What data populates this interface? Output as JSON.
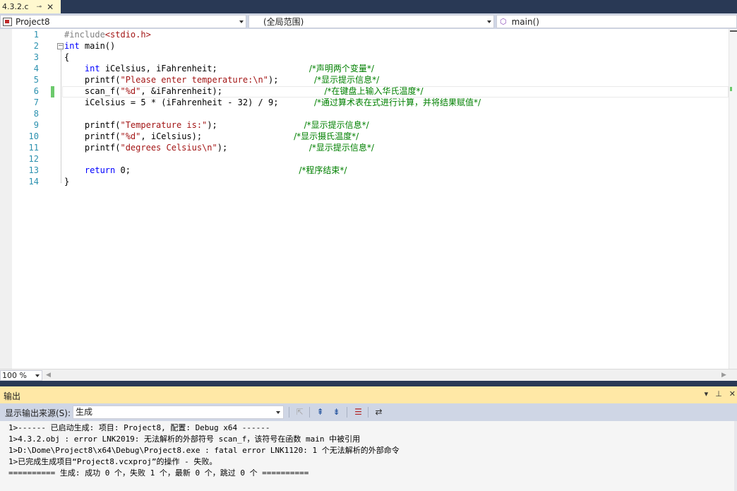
{
  "tab": {
    "title": "4.3.2.c",
    "pin": "⊸",
    "close": "✕"
  },
  "nav": {
    "project": "Project8",
    "scope": "(全局范围)",
    "member": "main()"
  },
  "editor": {
    "line_numbers": [
      "1",
      "2",
      "3",
      "4",
      "5",
      "6",
      "7",
      "8",
      "9",
      "10",
      "11",
      "12",
      "13",
      "14"
    ],
    "zoom": "100 %",
    "collapse_glyph": "−",
    "lines": [
      [
        {
          "t": "pp",
          "v": "#include"
        },
        {
          "t": "str",
          "v": "<stdio.h>"
        }
      ],
      [
        {
          "t": "kw",
          "v": "int"
        },
        {
          "t": "",
          "v": " main()"
        }
      ],
      [
        {
          "t": "",
          "v": "{"
        }
      ],
      [
        {
          "t": "",
          "v": "    "
        },
        {
          "t": "kw",
          "v": "int"
        },
        {
          "t": "",
          "v": " iCelsius, iFahrenheit;                  "
        },
        {
          "t": "cm",
          "v": "/*声明两个变量*/"
        }
      ],
      [
        {
          "t": "",
          "v": "    printf("
        },
        {
          "t": "str",
          "v": "\"Please enter temperature:\\n\""
        },
        {
          "t": "",
          "v": ");       "
        },
        {
          "t": "cm",
          "v": "/*显示提示信息*/"
        }
      ],
      [
        {
          "t": "",
          "v": "    scan_f("
        },
        {
          "t": "str",
          "v": "\"%d\""
        },
        {
          "t": "",
          "v": ", &iFahrenheit);                    "
        },
        {
          "t": "cm",
          "v": "/*在键盘上输入华氏温度*/"
        }
      ],
      [
        {
          "t": "",
          "v": "    iCelsius = 5 * (iFahrenheit - 32) / 9;       "
        },
        {
          "t": "cm",
          "v": "/*通过算术表在式进行计算，并将结果赋值*/"
        }
      ],
      [
        {
          "t": "",
          "v": ""
        }
      ],
      [
        {
          "t": "",
          "v": "    printf("
        },
        {
          "t": "str",
          "v": "\"Temperature is:\""
        },
        {
          "t": "",
          "v": ");                 "
        },
        {
          "t": "cm",
          "v": "/*显示提示信息*/"
        }
      ],
      [
        {
          "t": "",
          "v": "    printf("
        },
        {
          "t": "str",
          "v": "\"%d\""
        },
        {
          "t": "",
          "v": ", iCelsius);                  "
        },
        {
          "t": "cm",
          "v": "/*显示摄氏温度*/"
        }
      ],
      [
        {
          "t": "",
          "v": "    printf("
        },
        {
          "t": "str",
          "v": "\"degrees Celsius\\n\""
        },
        {
          "t": "",
          "v": ");                "
        },
        {
          "t": "cm",
          "v": "/*显示提示信息*/"
        }
      ],
      [
        {
          "t": "",
          "v": ""
        }
      ],
      [
        {
          "t": "",
          "v": "    "
        },
        {
          "t": "kw",
          "v": "return"
        },
        {
          "t": "",
          "v": " 0;                                 "
        },
        {
          "t": "cm",
          "v": "/*程序结束*/"
        }
      ],
      [
        {
          "t": "",
          "v": "}"
        }
      ]
    ]
  },
  "output": {
    "title": "输出",
    "source_label": "显示输出来源(S):",
    "source_value": "生成",
    "title_icons": {
      "dropdown": "▾",
      "pin": "⊥",
      "close": "✕"
    },
    "lines": [
      "1>------ 已启动生成: 项目: Project8, 配置: Debug x64 ------",
      "1>4.3.2.obj : error LNK2019: 无法解析的外部符号 scan_f，该符号在函数 main 中被引用",
      "1>D:\\Dome\\Project8\\x64\\Debug\\Project8.exe : fatal error LNK1120: 1 个无法解析的外部命令",
      "1>已完成生成项目“Project8.vcxproj”的操作 - 失败。",
      "========== 生成: 成功 0 个，失败 1 个，最新 0 个，跳过 0 个 =========="
    ]
  }
}
